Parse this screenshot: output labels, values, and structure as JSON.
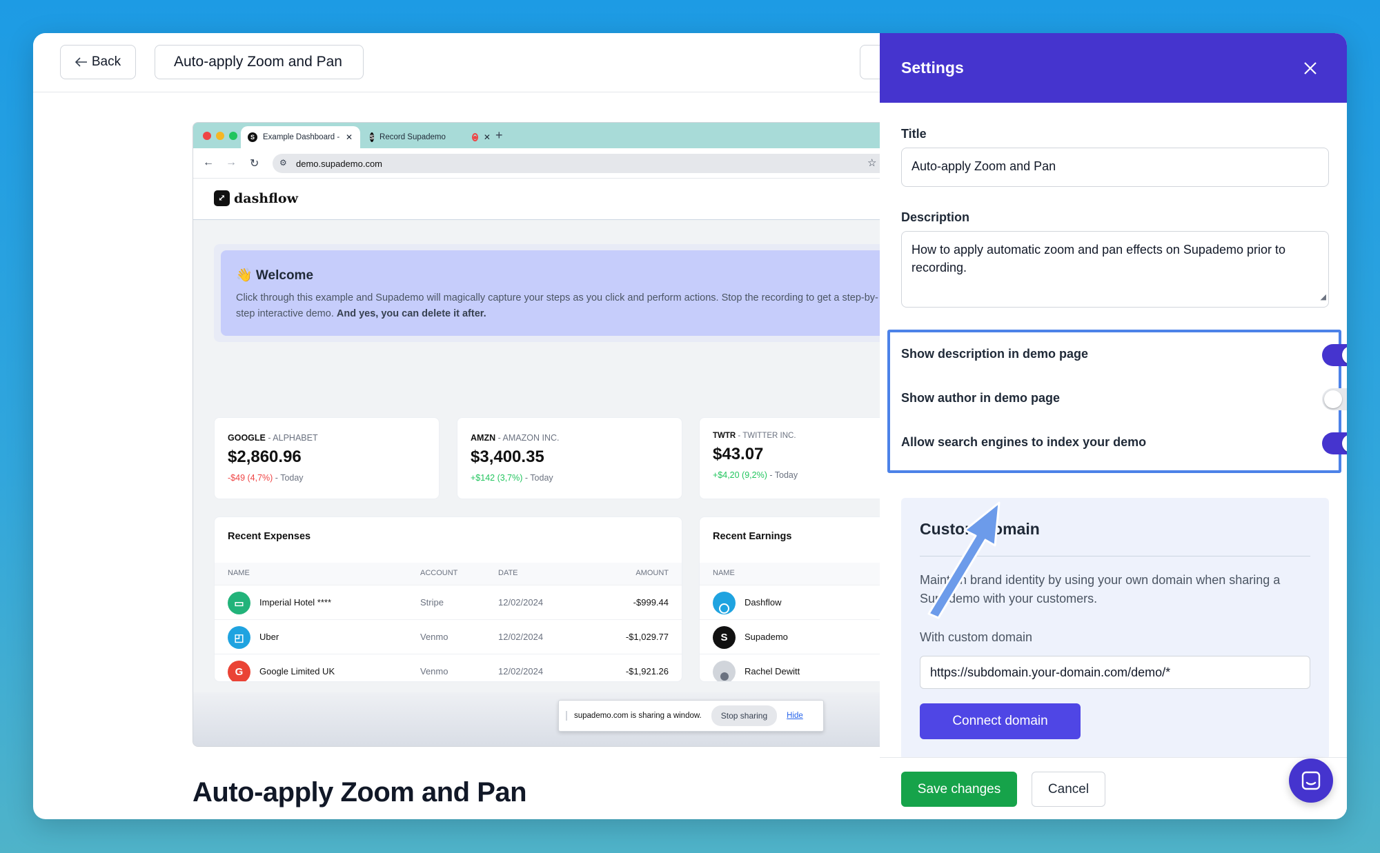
{
  "topbar": {
    "back_label": "Back",
    "demo_title": "Auto-apply Zoom and Pan"
  },
  "preview": {
    "tabs": [
      {
        "label": "Example Dashboard - Dashfl",
        "active": true
      },
      {
        "label": "Record Supademo",
        "active": false
      }
    ],
    "url": "demo.supademo.com",
    "app_name": "dashflow",
    "welcome": {
      "title": "👋 Welcome",
      "text": "Click through this example and Supademo will magically capture your steps as you click and perform actions. Stop the recording to get a step-by-step interactive demo. ",
      "text_bold": "And yes, you can delete it after."
    },
    "stocks": [
      {
        "ticker": "GOOGLE",
        "company": " - ALPHABET",
        "value": "$2,860.96",
        "change": "-$49 (4,7%)",
        "suffix": " - Today"
      },
      {
        "ticker": "AMZN",
        "company": " - AMAZON INC.",
        "value": "$3,400.35",
        "change": "+$142 (3,7%)",
        "suffix": " - Today"
      },
      {
        "ticker": "TWTR",
        "company": " - TWITTER INC.",
        "value": "$43.07",
        "change": "+$4,20 (9,2%)",
        "suffix": " - Today"
      }
    ],
    "expenses": {
      "title": "Recent Expenses",
      "headers": [
        "NAME",
        "ACCOUNT",
        "DATE",
        "AMOUNT"
      ],
      "rows": [
        {
          "name": "Imperial Hotel ****",
          "account": "Stripe",
          "date": "12/02/2024",
          "amount": "-$999.44"
        },
        {
          "name": "Uber",
          "account": "Venmo",
          "date": "12/02/2024",
          "amount": "-$1,029.77"
        },
        {
          "name": "Google Limited UK",
          "account": "Venmo",
          "date": "12/02/2024",
          "amount": "-$1,921.26"
        }
      ]
    },
    "earnings": {
      "title": "Recent Earnings",
      "headers": [
        "NAME"
      ],
      "rows": [
        {
          "name": "Dashflow"
        },
        {
          "name": "Supademo"
        },
        {
          "name": "Rachel Dewitt"
        }
      ]
    },
    "share_bar": {
      "text": "supademo.com is sharing a window.",
      "stop_label": "Stop sharing",
      "hide_label": "Hide"
    }
  },
  "page_title": "Auto-apply Zoom and Pan",
  "settings": {
    "header": "Settings",
    "title_label": "Title",
    "title_value": "Auto-apply Zoom and Pan",
    "description_label": "Description",
    "description_value": "How to apply automatic zoom and pan effects on Supademo prior to recording.",
    "toggles": [
      {
        "label": "Show description in demo page",
        "on": true
      },
      {
        "label": "Show author in demo page",
        "on": false
      },
      {
        "label": "Allow search engines to index your demo",
        "on": true
      }
    ],
    "custom_domain": {
      "title": "Custom domain",
      "description": "Maintain brand identity by using your own domain when sharing a Supademo with your customers.",
      "field_label": "With custom domain",
      "field_value": "https://subdomain.your-domain.com/demo/*",
      "connect_label": "Connect domain"
    },
    "save_label": "Save changes",
    "cancel_label": "Cancel"
  },
  "colors": {
    "brand": "#4534ce",
    "connect": "#4f46e5",
    "save": "#16a34a",
    "highlight": "#4c82e8"
  }
}
